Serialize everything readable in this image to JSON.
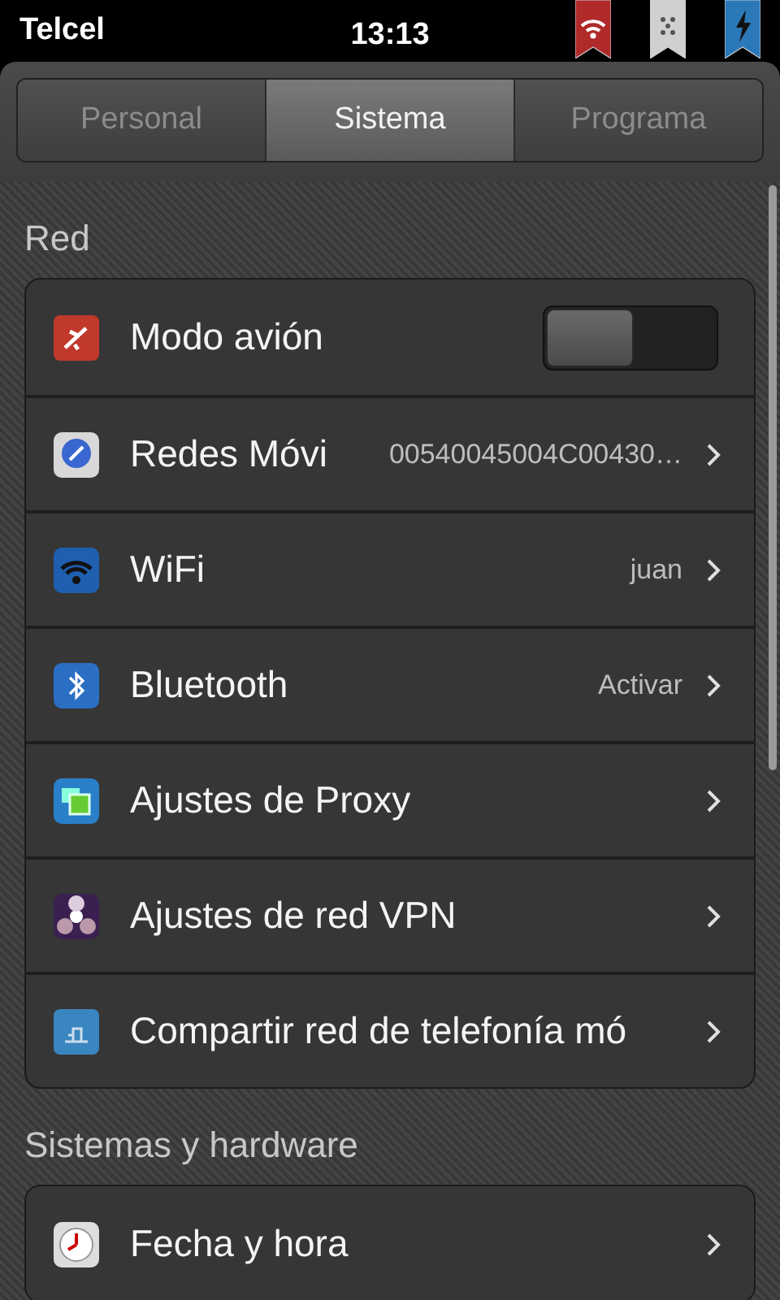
{
  "status_bar": {
    "carrier": "Telcel",
    "time": "13:13"
  },
  "tabs": [
    {
      "label": "Personal",
      "selected": false
    },
    {
      "label": "Sistema",
      "selected": true
    },
    {
      "label": "Programa",
      "selected": false
    }
  ],
  "sections": [
    {
      "title": "Red",
      "rows": [
        {
          "kind": "toggle",
          "label": "Modo avión",
          "on": false
        },
        {
          "kind": "link",
          "label": "Redes Móvi",
          "value": "00540045004C00430…"
        },
        {
          "kind": "link",
          "label": "WiFi",
          "value": "juan"
        },
        {
          "kind": "link",
          "label": "Bluetooth",
          "value": "Activar"
        },
        {
          "kind": "link",
          "label": "Ajustes de Proxy"
        },
        {
          "kind": "link",
          "label": "Ajustes de red VPN"
        },
        {
          "kind": "link",
          "label": "Compartir red de telefonía mó"
        }
      ]
    },
    {
      "title": "Sistemas y hardware",
      "rows": [
        {
          "kind": "link",
          "label": "Fecha y hora"
        }
      ]
    }
  ]
}
